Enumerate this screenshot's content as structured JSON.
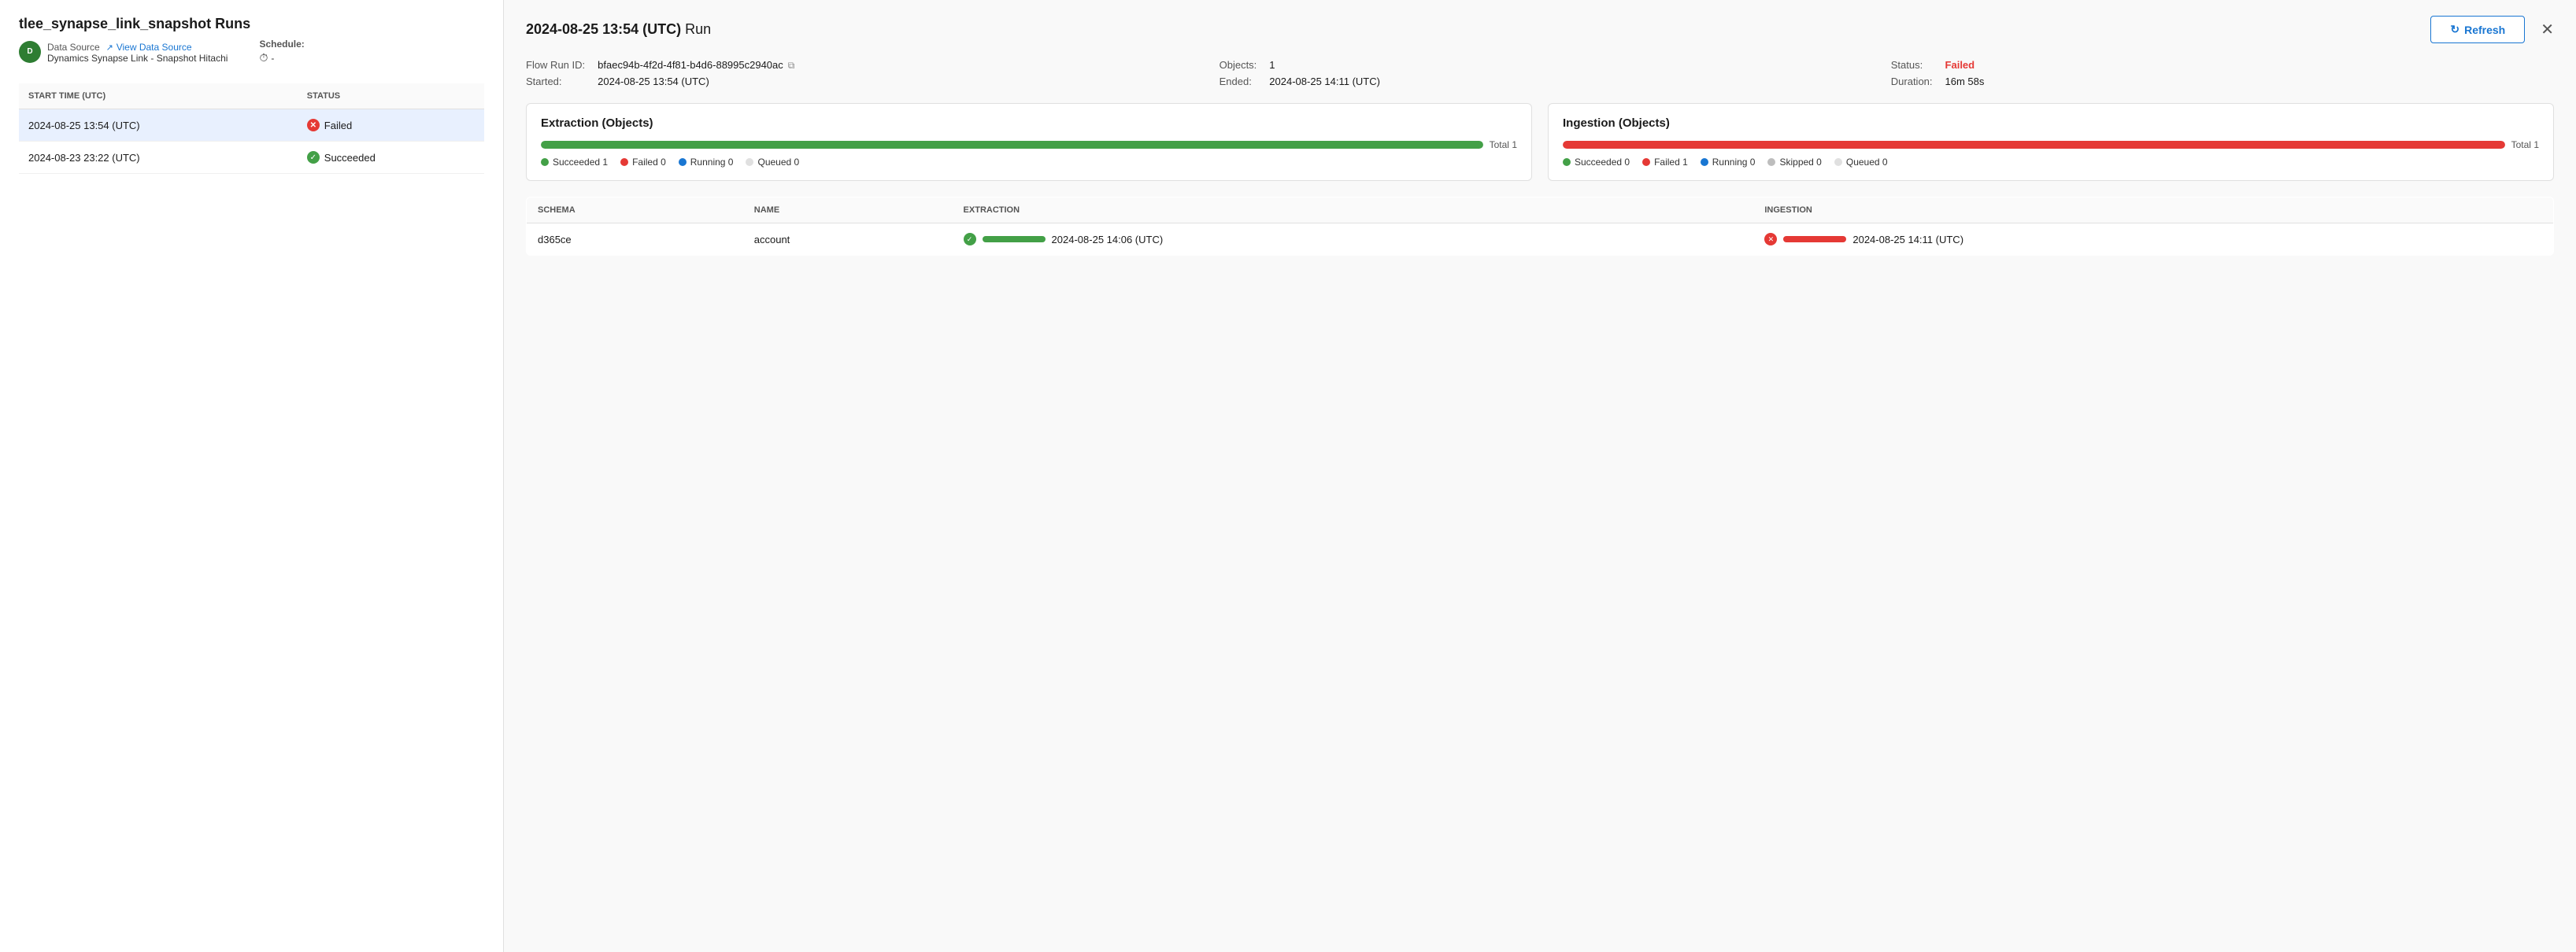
{
  "left": {
    "title": "tlee_synapse_link_snapshot",
    "runs_label": "Runs",
    "data_source_label": "Data Source",
    "view_data_source_link": "View Data Source",
    "ds_name": "Dynamics Synapse Link - Snapshot Hitachi",
    "schedule_label": "Schedule:",
    "schedule_value": "-",
    "table_headers": [
      "START TIME (UTC)",
      "STATUS"
    ],
    "rows": [
      {
        "start_time": "2024-08-25 13:54 (UTC)",
        "status": "Failed",
        "status_type": "failed"
      },
      {
        "start_time": "2024-08-23 23:22 (UTC)",
        "status": "Succeeded",
        "status_type": "succeeded"
      }
    ]
  },
  "right": {
    "run_date": "2024-08-25 13:54 (UTC)",
    "run_label": "Run",
    "refresh_label": "Refresh",
    "flow_run_id_label": "Flow Run ID:",
    "flow_run_id": "bfaec94b-4f2d-4f81-b4d6-88995c2940ac",
    "objects_label": "Objects:",
    "objects_value": "1",
    "status_label": "Status:",
    "status_value": "Failed",
    "started_label": "Started:",
    "started_value": "2024-08-25 13:54 (UTC)",
    "ended_label": "Ended:",
    "ended_value": "2024-08-25 14:11 (UTC)",
    "duration_label": "Duration:",
    "duration_value": "16m 58s",
    "extraction_card": {
      "title": "Extraction (Objects)",
      "total_label": "Total",
      "total_value": 1,
      "progress_pct": 100,
      "bar_type": "green",
      "legend": [
        {
          "label": "Succeeded",
          "value": "1",
          "dot": "green"
        },
        {
          "label": "Failed",
          "value": "0",
          "dot": "red"
        },
        {
          "label": "Running",
          "value": "0",
          "dot": "blue"
        },
        {
          "label": "Queued",
          "value": "0",
          "dot": "lgray"
        }
      ]
    },
    "ingestion_card": {
      "title": "Ingestion (Objects)",
      "total_label": "Total",
      "total_value": 1,
      "progress_pct": 100,
      "bar_type": "red",
      "legend": [
        {
          "label": "Succeeded",
          "value": "0",
          "dot": "green"
        },
        {
          "label": "Failed",
          "value": "1",
          "dot": "red"
        },
        {
          "label": "Running",
          "value": "0",
          "dot": "blue"
        },
        {
          "label": "Skipped",
          "value": "0",
          "dot": "gray"
        },
        {
          "label": "Queued",
          "value": "0",
          "dot": "lgray"
        }
      ]
    },
    "detail_table": {
      "headers": [
        "SCHEMA",
        "NAME",
        "EXTRACTION",
        "INGESTION"
      ],
      "rows": [
        {
          "schema": "d365ce",
          "name": "account",
          "extraction_status": "success",
          "extraction_date": "2024-08-25 14:06 (UTC)",
          "ingestion_status": "failed",
          "ingestion_date": "2024-08-25 14:11 (UTC)"
        }
      ]
    }
  }
}
